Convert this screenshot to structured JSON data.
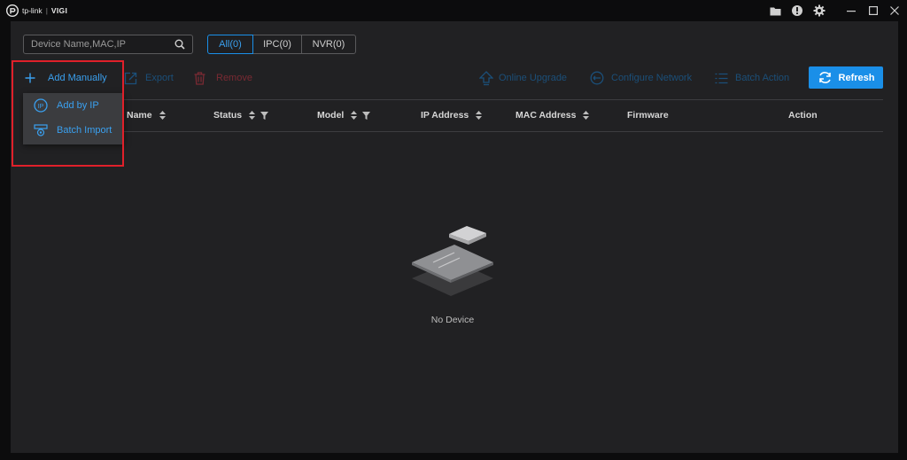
{
  "app": {
    "brand": "tp-link",
    "product": "VIGI"
  },
  "window_controls": {
    "folder_icon": "folder-icon",
    "alert_icon": "alert-icon",
    "settings_icon": "gear-icon",
    "minimize_icon": "minimize-icon",
    "maximize_icon": "maximize-icon",
    "close_icon": "close-icon"
  },
  "search": {
    "placeholder": "Device Name,MAC,IP",
    "value": ""
  },
  "filter_tabs": [
    {
      "label": "All(0)",
      "active": true
    },
    {
      "label": "IPC(0)",
      "active": false
    },
    {
      "label": "NVR(0)",
      "active": false
    }
  ],
  "toolbar": {
    "add_manually": "Add Manually",
    "export": "Export",
    "remove": "Remove",
    "online_upgrade": "Online Upgrade",
    "configure_network": "Configure Network",
    "batch_action": "Batch Action",
    "refresh": "Refresh"
  },
  "add_menu": {
    "add_by_ip": "Add by IP",
    "batch_import": "Batch Import"
  },
  "table": {
    "columns": [
      "Name",
      "Status",
      "Model",
      "IP Address",
      "MAC Address",
      "Firmware",
      "Action"
    ]
  },
  "empty_state": {
    "text": "No Device"
  },
  "colors": {
    "accent": "#1a8fe8",
    "background": "#212123",
    "highlight": "#e0202a",
    "remove": "#7a2a33"
  }
}
